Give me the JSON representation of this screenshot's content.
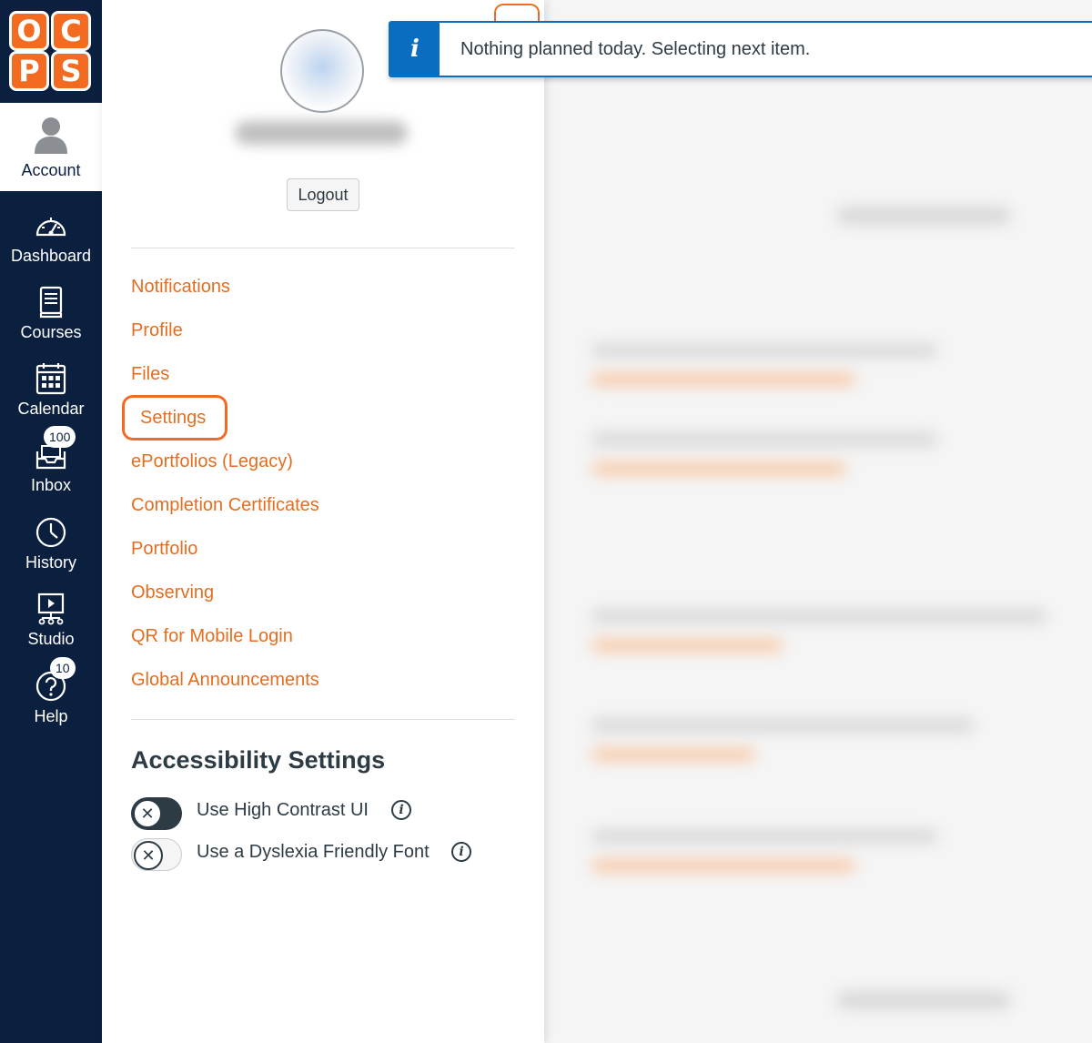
{
  "logo": {
    "letters": [
      "O",
      "C",
      "P",
      "S"
    ]
  },
  "nav": {
    "account": "Account",
    "dashboard": "Dashboard",
    "courses": "Courses",
    "calendar": "Calendar",
    "inbox": "Inbox",
    "inbox_badge": "100",
    "history": "History",
    "studio": "Studio",
    "help": "Help",
    "help_badge": "10"
  },
  "tray": {
    "logout": "Logout",
    "links": [
      "Notifications",
      "Profile",
      "Files",
      "Settings",
      "ePortfolios (Legacy)",
      "Completion Certificates",
      "Portfolio",
      "Observing",
      "QR for Mobile Login",
      "Global Announcements"
    ],
    "accessibility": {
      "title": "Accessibility Settings",
      "high_contrast": "Use High Contrast UI",
      "high_contrast_on": true,
      "dyslexia_font": "Use a Dyslexia Friendly Font",
      "dyslexia_font_on": false
    }
  },
  "alert": {
    "icon": "i",
    "message": "Nothing planned today. Selecting next item."
  },
  "colors": {
    "nav_bg": "#0b1f3f",
    "link": "#e66d1d",
    "accent_orange": "#f26b21",
    "alert_blue": "#0a6dbf",
    "text": "#2d3b45"
  }
}
